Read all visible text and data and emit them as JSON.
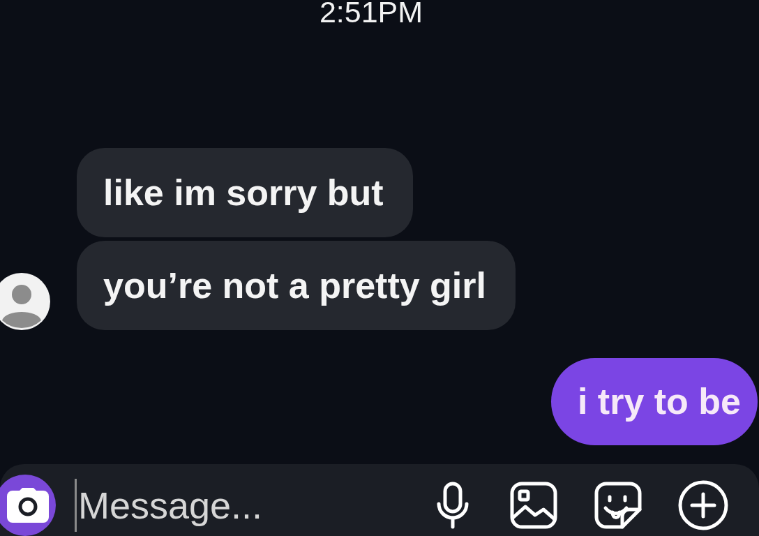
{
  "timestamp": "2:51PM",
  "messages": [
    {
      "kind": "received",
      "text": "like im sorry but"
    },
    {
      "kind": "received",
      "text": "you’re not a pretty girl"
    },
    {
      "kind": "sent",
      "text": "i try to be"
    }
  ],
  "composer": {
    "placeholder": "Message..."
  }
}
